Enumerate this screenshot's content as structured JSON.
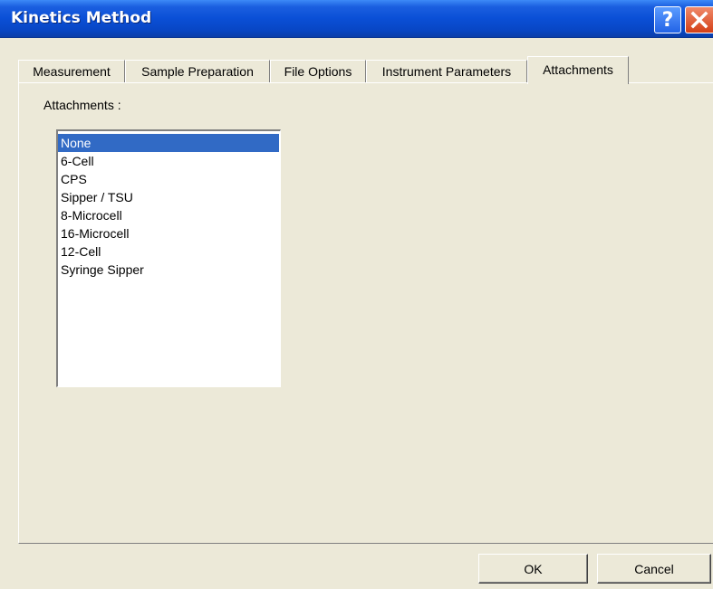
{
  "window": {
    "title": "Kinetics Method",
    "help_glyph": "?",
    "close_glyph": "✕"
  },
  "tabs": [
    {
      "label": "Measurement"
    },
    {
      "label": "Sample Preparation"
    },
    {
      "label": "File Options"
    },
    {
      "label": "Instrument Parameters"
    },
    {
      "label": "Attachments",
      "active": true
    }
  ],
  "attachments": {
    "label": "Attachments :",
    "items": [
      "None",
      "6-Cell",
      "CPS",
      "Sipper / TSU",
      "8-Microcell",
      "16-Microcell",
      "12-Cell",
      "Syringe Sipper"
    ],
    "selected": "None"
  },
  "buttons": {
    "ok": "OK",
    "cancel": "Cancel"
  },
  "colors": {
    "titlebar": "#0a4fd6",
    "selection": "#316ac5",
    "dialog_bg": "#ece9d8",
    "close_button": "#d43f16"
  }
}
